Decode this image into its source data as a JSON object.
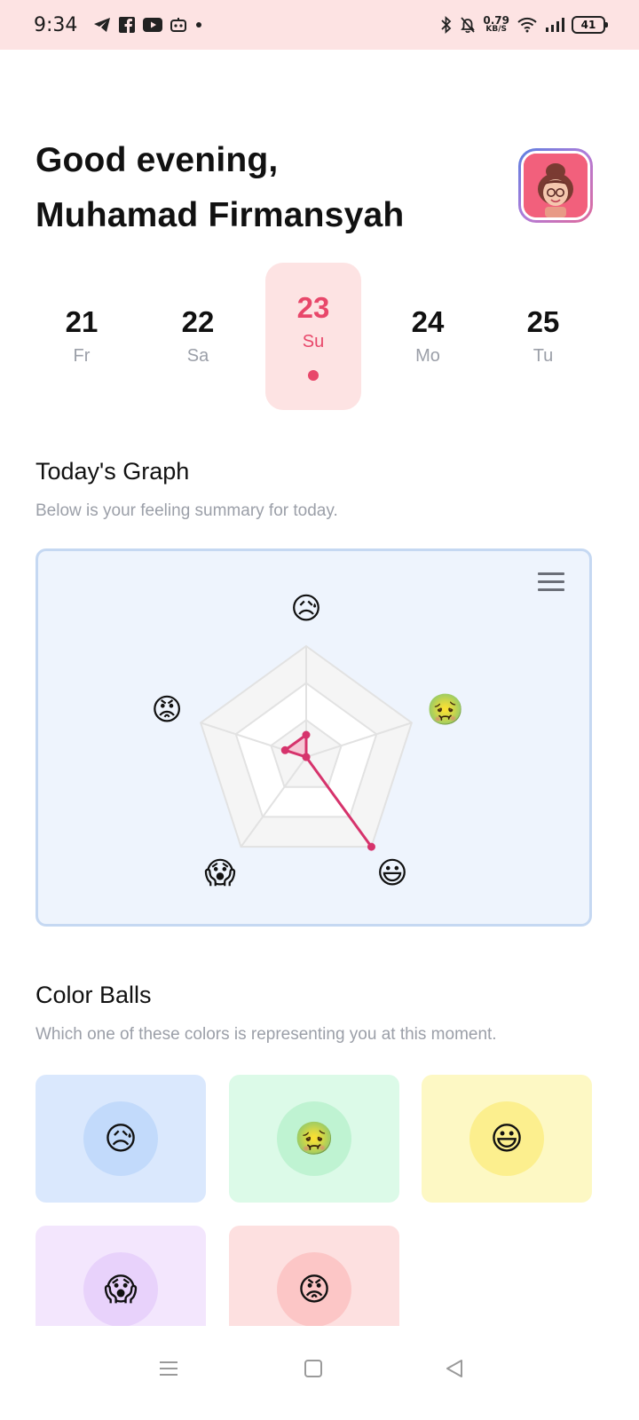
{
  "status_bar": {
    "time": "9:34",
    "net_speed_value": "0.79",
    "net_speed_unit": "KB/S",
    "battery": "41",
    "icons": [
      "telegram-icon",
      "facebook-icon",
      "youtube-icon",
      "robot-icon",
      "dot-icon",
      "bluetooth-icon",
      "mute-bell-icon",
      "wifi-icon",
      "signal-icon",
      "battery-icon"
    ]
  },
  "greeting": {
    "line1": "Good evening,",
    "line2": "Muhamad Firmansyah",
    "avatar_icon": "profile-avatar"
  },
  "dates": [
    {
      "num": "21",
      "day": "Fr",
      "active": false
    },
    {
      "num": "22",
      "day": "Sa",
      "active": false
    },
    {
      "num": "23",
      "day": "Su",
      "active": true
    },
    {
      "num": "24",
      "day": "Mo",
      "active": false
    },
    {
      "num": "25",
      "day": "Tu",
      "active": false
    }
  ],
  "graph": {
    "title": "Today's Graph",
    "subtitle": "Below is your feeling summary for today.",
    "menu_icon": "hamburger-menu-icon"
  },
  "chart_data": {
    "type": "radar",
    "categories": [
      "😥",
      "🤢",
      "😃",
      "😱",
      "😡"
    ],
    "values": [
      1,
      0,
      5,
      0,
      1
    ],
    "rlim": [
      0,
      5
    ],
    "grid_levels": 3,
    "colors": {
      "series": "#d6336c",
      "fill": "#f5b5c9",
      "grid_fill": "#f5f5f5",
      "grid_line": "#e2e2e2"
    }
  },
  "color_balls": {
    "title": "Color Balls",
    "subtitle": "Which one of these colors is representing you at this moment.",
    "items": [
      {
        "emoji": "😥",
        "mood": "sad",
        "card_color": "#dae8fd",
        "ball_color": "#c2dafb"
      },
      {
        "emoji": "🤢",
        "mood": "sick",
        "card_color": "#dcfae8",
        "ball_color": "#bff3d2"
      },
      {
        "emoji": "😃",
        "mood": "happy",
        "card_color": "#fdf8c4",
        "ball_color": "#fcef8e"
      },
      {
        "emoji": "😱",
        "mood": "scared",
        "card_color": "#f3e6fd",
        "ball_color": "#e8d2fb"
      },
      {
        "emoji": "😡",
        "mood": "angry",
        "card_color": "#fde0e0",
        "ball_color": "#fcc6c6"
      }
    ]
  },
  "nav": {
    "icons": [
      "recent-apps-icon",
      "home-icon",
      "back-icon"
    ]
  }
}
